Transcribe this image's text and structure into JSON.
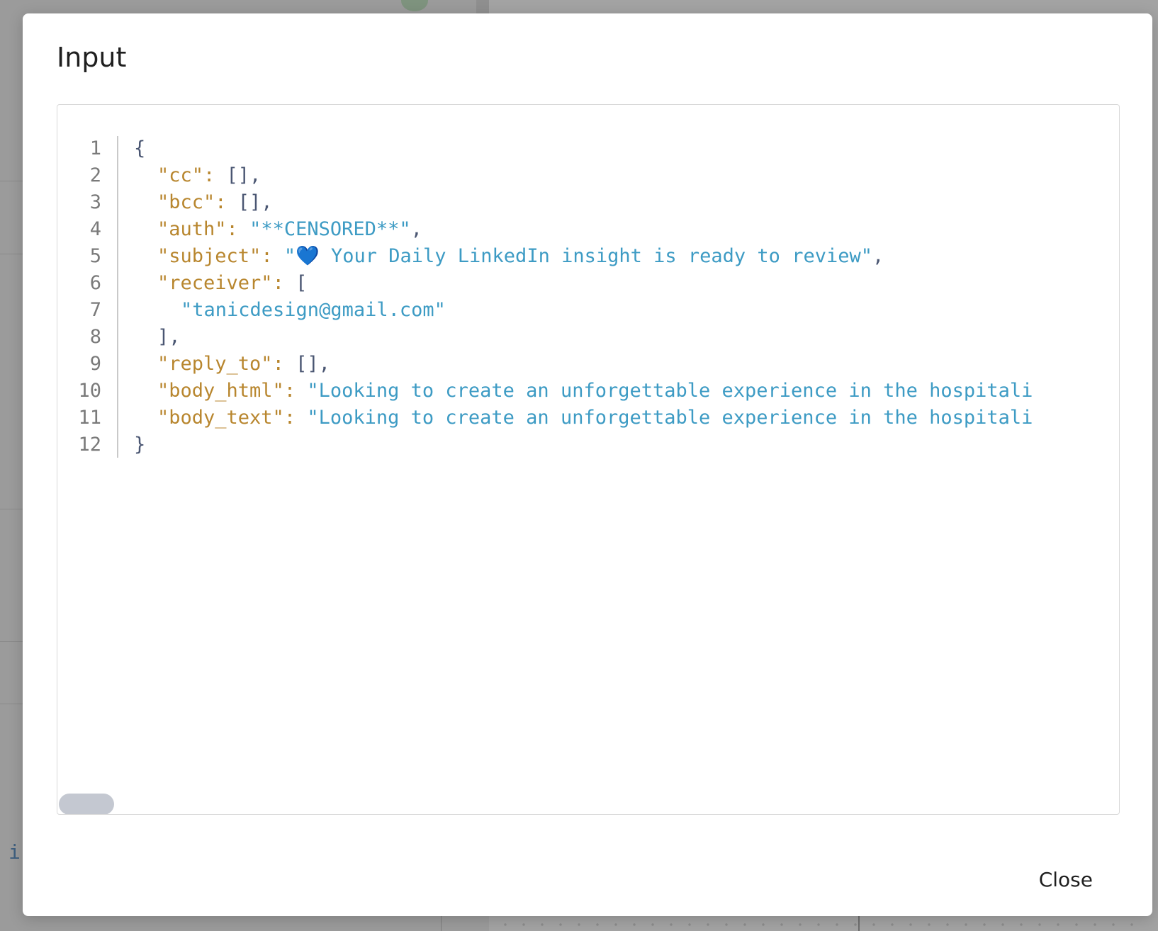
{
  "modal": {
    "title": "Input",
    "close_label": "Close"
  },
  "background": {
    "partial_letter": "i"
  },
  "editor": {
    "line_numbers": [
      "1",
      "2",
      "3",
      "4",
      "5",
      "6",
      "7",
      "8",
      "9",
      "10",
      "11",
      "12"
    ],
    "lines": [
      {
        "punct_open": "{"
      },
      {
        "key": "\"cc\"",
        "sep": ": ",
        "punct": "[],"
      },
      {
        "key": "\"bcc\"",
        "sep": ": ",
        "punct": "[],"
      },
      {
        "key": "\"auth\"",
        "sep": ": ",
        "value": "\"**CENSORED**\"",
        "punct": ","
      },
      {
        "key": "\"subject\"",
        "sep": ": ",
        "value_start": "\"",
        "emoji": "💙",
        "value": " Your Daily LinkedIn insight is ready to review\"",
        "punct": ","
      },
      {
        "key": "\"receiver\"",
        "sep": ": ",
        "punct": "["
      },
      {
        "value": "\"tanicdesign@gmail.com\""
      },
      {
        "punct": "],"
      },
      {
        "key": "\"reply_to\"",
        "sep": ": ",
        "punct": "[],"
      },
      {
        "key": "\"body_html\"",
        "sep": ": ",
        "value": "\"Looking to create an unforgettable experience in the hospitali"
      },
      {
        "key": "\"body_text\"",
        "sep": ": ",
        "value": "\"Looking to create an unforgettable experience in the hospitali"
      },
      {
        "punct_open": "}"
      }
    ]
  }
}
